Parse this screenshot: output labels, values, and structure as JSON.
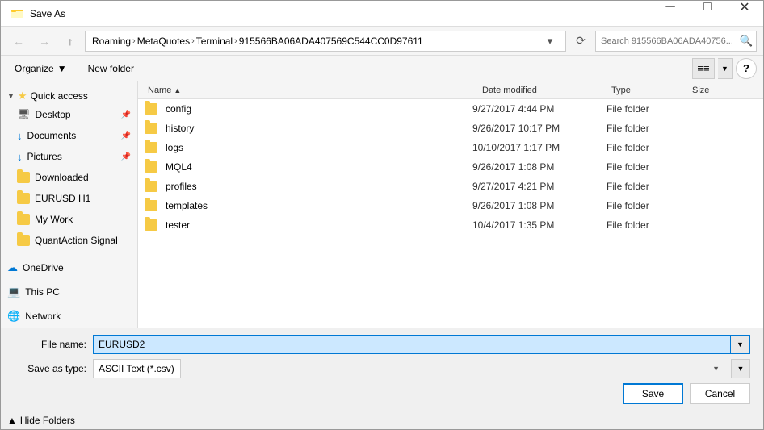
{
  "titleBar": {
    "title": "Save As",
    "closeBtn": "✕",
    "minimizeBtn": "─",
    "maximizeBtn": "□"
  },
  "navigation": {
    "backBtn": "←",
    "forwardBtn": "→",
    "upBtn": "↑",
    "addressParts": [
      "Roaming",
      "MetaQuotes",
      "Terminal",
      "915566BA06ADA407569C544CC0D97611"
    ],
    "refreshBtn": "⟳",
    "searchPlaceholder": "Search 915566BA06ADA40756...",
    "searchIcon": "🔍"
  },
  "toolbar2": {
    "organizeLabel": "Organize",
    "newFolderLabel": "New folder",
    "viewIcon": "⊞",
    "helpIcon": "?"
  },
  "sidebar": {
    "quickAccessLabel": "Quick access",
    "items": [
      {
        "label": "Desktop",
        "type": "desktop",
        "pinned": true
      },
      {
        "label": "Documents",
        "type": "doc",
        "pinned": true
      },
      {
        "label": "Pictures",
        "type": "pic",
        "pinned": true
      },
      {
        "label": "Downloaded",
        "type": "folder",
        "pinned": false
      },
      {
        "label": "EURUSD H1",
        "type": "folder",
        "pinned": false
      },
      {
        "label": "My Work",
        "type": "folder",
        "pinned": false
      },
      {
        "label": "QuantAction Signal",
        "type": "folder",
        "pinned": false
      }
    ],
    "oneDriveLabel": "OneDrive",
    "thisPcLabel": "This PC",
    "networkLabel": "Network"
  },
  "fileList": {
    "columns": [
      "Name",
      "Date modified",
      "Type",
      "Size"
    ],
    "sortIndicator": "▲",
    "rows": [
      {
        "name": "config",
        "date": "9/27/2017 4:44 PM",
        "type": "File folder",
        "size": ""
      },
      {
        "name": "history",
        "date": "9/26/2017 10:17 PM",
        "type": "File folder",
        "size": ""
      },
      {
        "name": "logs",
        "date": "10/10/2017 1:17 PM",
        "type": "File folder",
        "size": ""
      },
      {
        "name": "MQL4",
        "date": "9/26/2017 1:08 PM",
        "type": "File folder",
        "size": ""
      },
      {
        "name": "profiles",
        "date": "9/27/2017 4:21 PM",
        "type": "File folder",
        "size": ""
      },
      {
        "name": "templates",
        "date": "9/26/2017 1:08 PM",
        "type": "File folder",
        "size": ""
      },
      {
        "name": "tester",
        "date": "10/4/2017 1:35 PM",
        "type": "File folder",
        "size": ""
      }
    ]
  },
  "bottomForm": {
    "fileNameLabel": "File name:",
    "fileNameValue": "EURUSD2",
    "saveAsTypeLabel": "Save as type:",
    "saveAsTypeValue": "ASCII Text (*.csv)",
    "saveLabel": "Save",
    "cancelLabel": "Cancel"
  },
  "footer": {
    "hideFoldersLabel": "Hide Folders",
    "collapseIcon": "▲"
  }
}
